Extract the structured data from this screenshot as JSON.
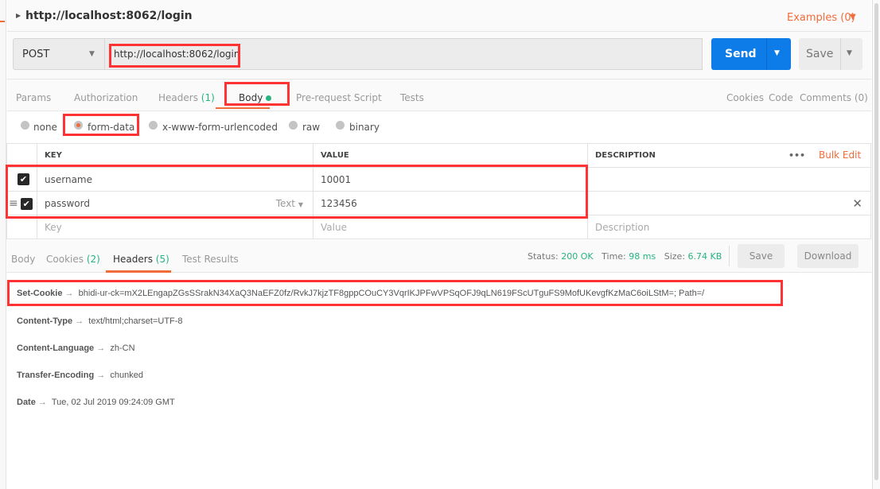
{
  "request": {
    "title": "http://localhost:8062/login",
    "examples": "Examples (0)",
    "method": "POST",
    "url": "http://localhost:8062/login",
    "send": "Send",
    "save": "Save"
  },
  "tabs": {
    "params": "Params",
    "authorization": "Authorization",
    "headers": "Headers",
    "headers_count": "(1)",
    "body": "Body",
    "prerequest": "Pre-request Script",
    "tests": "Tests",
    "cookies": "Cookies",
    "code": "Code",
    "comments": "Comments (0)"
  },
  "body_modes": {
    "none": "none",
    "form_data": "form-data",
    "urlencoded": "x-www-form-urlencoded",
    "raw": "raw",
    "binary": "binary",
    "selected": "form-data"
  },
  "table": {
    "headers": {
      "key": "KEY",
      "value": "VALUE",
      "description": "DESCRIPTION",
      "more": "•••",
      "bulk_edit": "Bulk Edit"
    },
    "rows": [
      {
        "key": "username",
        "value": "10001",
        "checked": true
      },
      {
        "key": "password",
        "value": "123456",
        "checked": true,
        "type": "Text"
      }
    ],
    "placeholders": {
      "key": "Key",
      "value": "Value",
      "description": "Description"
    }
  },
  "response": {
    "tabs": {
      "body": "Body",
      "cookies": "Cookies",
      "cookies_count": "(2)",
      "headers": "Headers",
      "headers_count": "(5)",
      "test_results": "Test Results"
    },
    "status_label": "Status:",
    "status": "200 OK",
    "time_label": "Time:",
    "time": "98 ms",
    "size_label": "Size:",
    "size": "6.74 KB",
    "save": "Save",
    "download": "Download",
    "headers": [
      {
        "name": "Set-Cookie",
        "value": "bhidi-ur-ck=mX2LEngapZGsSSrakN34XaQ3NaEFZ0fz/RvkJ7kjzTF8gppCOuCY3VqrIKJPFwVPSqOFJ9qLN619FScUTguFS9MofUKevgfKzMaC6oiLStM=; Path=/"
      },
      {
        "name": "Content-Type",
        "value": "text/html;charset=UTF-8"
      },
      {
        "name": "Content-Language",
        "value": "zh-CN"
      },
      {
        "name": "Transfer-Encoding",
        "value": "chunked"
      },
      {
        "name": "Date",
        "value": "Tue, 02 Jul 2019 09:24:09 GMT"
      }
    ]
  },
  "colors": {
    "accent": "#f26b3a",
    "send": "#0d7be8",
    "success": "#26b47f",
    "highlight": "#ff3333"
  }
}
